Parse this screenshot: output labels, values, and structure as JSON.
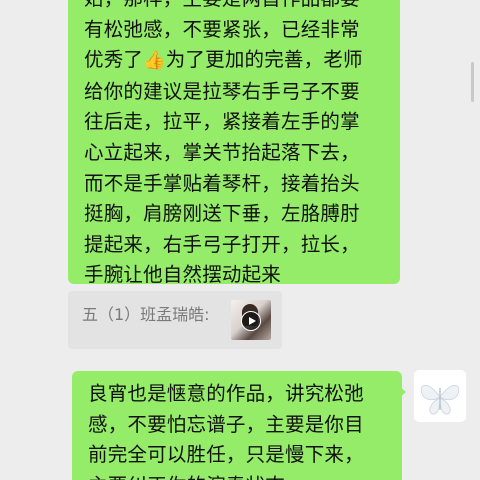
{
  "messages": {
    "first": {
      "lines": [
        "始，那样，主要是两首作品都要",
        "有松弛感，不要紧张，已经非常",
        "优秀了",
        "为了更加的完善，老师",
        "给你的建议是拉琴右手弓子不要",
        "往后走，拉平，紧接着左手的掌",
        "心立起来，掌关节抬起落下去，",
        "而不是手掌贴着琴杆，接着抬头",
        "挺胸，肩膀刚送下垂，左胳膊肘",
        "提起来，右手弓子打开，拉长，",
        "手腕让他自然摆动起来"
      ],
      "emoji": "👍",
      "bubble_color": "#95ec69"
    },
    "quote": {
      "text": "五（1）班孟瑞皓:",
      "media_type": "video",
      "card_color": "#e3e3e3"
    },
    "second": {
      "lines": [
        "良宵也是惬意的作品，讲究松弛",
        "感，不要怕忘谱子，主要是你目",
        "前完全可以胜任，只是慢下来，",
        "主要纠正你的演奏状态"
      ]
    },
    "avatar": {
      "icon": "butterfly-icon"
    }
  },
  "colors": {
    "background": "#ededed",
    "bubble_green": "#95ec69",
    "text": "#111111",
    "quote_text": "#7a7a7a"
  }
}
